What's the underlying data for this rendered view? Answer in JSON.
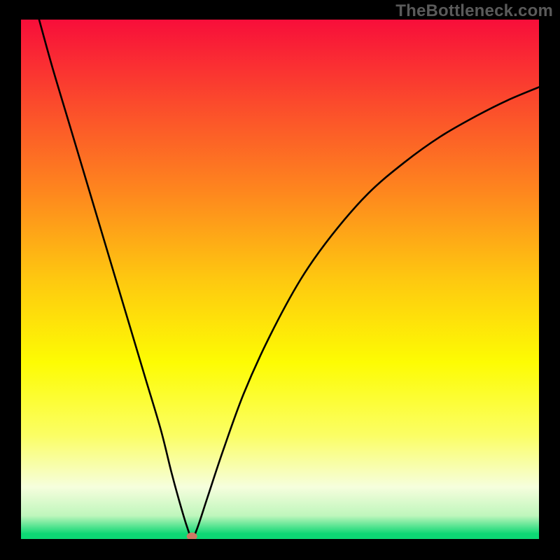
{
  "watermark": "TheBottleneck.com",
  "chart_data": {
    "type": "line",
    "title": "",
    "xlabel": "",
    "ylabel": "",
    "xlim": [
      0,
      100
    ],
    "ylim": [
      0,
      100
    ],
    "grid": false,
    "background_gradient": {
      "stops": [
        {
          "offset": 0.0,
          "color": "#f80e3a"
        },
        {
          "offset": 0.16,
          "color": "#fb4a2c"
        },
        {
          "offset": 0.33,
          "color": "#fe861e"
        },
        {
          "offset": 0.5,
          "color": "#fec810"
        },
        {
          "offset": 0.66,
          "color": "#fdfc03"
        },
        {
          "offset": 0.8,
          "color": "#fbfe64"
        },
        {
          "offset": 0.9,
          "color": "#f6fedd"
        },
        {
          "offset": 0.955,
          "color": "#bff6bc"
        },
        {
          "offset": 0.99,
          "color": "#0dd874"
        }
      ]
    },
    "marker": {
      "x": 33,
      "y": 0.5,
      "color": "#cd7864"
    },
    "series": [
      {
        "name": "curve",
        "color": "#000000",
        "x": [
          3.5,
          6,
          9,
          12,
          15,
          18,
          21,
          24,
          27,
          29,
          30.5,
          32,
          33,
          34,
          36,
          39,
          43,
          48,
          54,
          60,
          67,
          74,
          81,
          88,
          94,
          100
        ],
        "y": [
          100,
          91,
          81,
          71,
          61,
          51,
          41,
          31,
          21,
          13,
          7.5,
          2.5,
          0.2,
          2,
          8,
          17,
          28,
          39,
          50,
          58.5,
          66.5,
          72.5,
          77.5,
          81.5,
          84.5,
          87
        ]
      }
    ]
  }
}
